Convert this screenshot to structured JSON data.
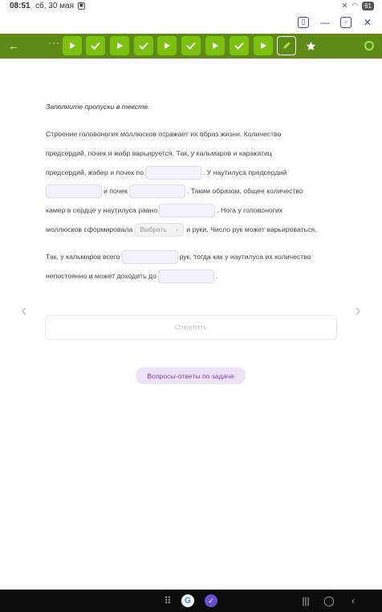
{
  "status_bar": {
    "time": "08:51",
    "date": "сб, 30 мая",
    "battery": "61"
  },
  "toolbar": {
    "steps": [
      {
        "type": "play"
      },
      {
        "type": "check"
      },
      {
        "type": "play"
      },
      {
        "type": "check"
      },
      {
        "type": "play"
      },
      {
        "type": "check"
      },
      {
        "type": "play"
      },
      {
        "type": "check"
      },
      {
        "type": "play"
      },
      {
        "type": "pen",
        "active": true
      },
      {
        "type": "star"
      }
    ],
    "colors": {
      "bar": "#5e8a18",
      "step": "#7cc10f"
    }
  },
  "task": {
    "instruction": "Заполните пропуски в тексте.",
    "p1": {
      "l1": "Строение головоногих моллюсков отражает их образ жизни. Количество",
      "l2": "предсердий, почек и жабр варьируется. Так, у кальмаров и каракатиц",
      "l3a": "предсердий, жабер и почек по",
      "l3b": ". У наутилуса предсердий",
      "l4a": "и почек",
      "l4b": ". Таким образом, общее количество",
      "l5a": "камер в сердце у наутилуса равно",
      "l5b": ". Нога у головоногих",
      "l6a": "моллюсков сформировала",
      "select_placeholder": "Выбрать",
      "l6b": "и руки. Число рук может варьироваться."
    },
    "p2": {
      "l1a": "Так, у кальмаров всего",
      "l1b": "рук, тогда как у наутилуса их количество",
      "l2a": "непостоянно и может доходить до",
      "l2b": "."
    }
  },
  "buttons": {
    "answer": "Ответить",
    "qa": "Вопросы-ответы по задаче"
  }
}
